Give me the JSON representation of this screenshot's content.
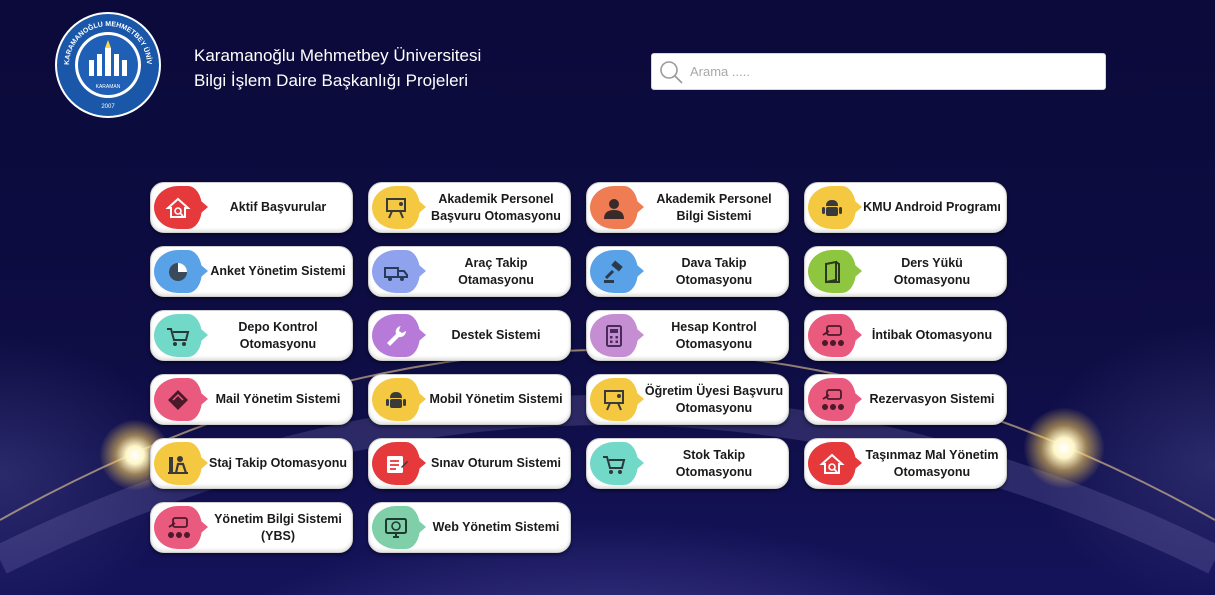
{
  "header": {
    "logo_icon": "university-seal-icon",
    "logo_text": "KARAMANOĞLU MEHMETBEY ÜNİVERSİTESİ",
    "logo_sub": "KARAMAN",
    "logo_year": "2007",
    "title_line1": "Karamanoğlu Mehmetbey Üniversitesi",
    "title_line2": "Bilgi İşlem Daire Başkanlığı Projeleri"
  },
  "search": {
    "placeholder": "Arama .....",
    "value": ""
  },
  "tiles": [
    {
      "label": "Aktif Başvurular",
      "icon": "house-search-icon",
      "color": "#e5393c"
    },
    {
      "label": "Akademik Personel Başvuru Otomasyonu",
      "icon": "presentation-board-icon",
      "color": "#f5c842"
    },
    {
      "label": "Akademik Personel Bilgi Sistemi",
      "icon": "person-silhouette-icon",
      "color": "#ef7c52"
    },
    {
      "label": "KMU Android Programı",
      "icon": "android-icon",
      "color": "#f5c842"
    },
    {
      "label": "Anket Yönetim Sistemi",
      "icon": "pie-chart-icon",
      "color": "#5aa2e8"
    },
    {
      "label": "Araç Takip Otamasyonu",
      "icon": "truck-icon",
      "color": "#8ea2ee"
    },
    {
      "label": "Dava Takip Otomasyonu",
      "icon": "gavel-icon",
      "color": "#5aa2e8"
    },
    {
      "label": "Ders Yükü Otomasyonu",
      "icon": "book-icon",
      "color": "#8ec63f"
    },
    {
      "label": "Depo Kontrol Otomasyonu",
      "icon": "shopping-cart-icon",
      "color": "#72d8c8"
    },
    {
      "label": "Destek Sistemi",
      "icon": "wrench-icon",
      "color": "#b77ad9"
    },
    {
      "label": "Hesap Kontrol Otomasyonu",
      "icon": "calculator-icon",
      "color": "#c58ed2"
    },
    {
      "label": "İntibak Otomasyonu",
      "icon": "chat-network-icon",
      "color": "#ea5a7e"
    },
    {
      "label": "Mail Yönetim Sistemi",
      "icon": "envelope-icon",
      "color": "#ea5a7e"
    },
    {
      "label": "Mobil Yönetim Sistemi",
      "icon": "android-icon",
      "color": "#f5c842"
    },
    {
      "label": "Öğretim Üyesi Başvuru Otomasyonu",
      "icon": "presentation-board-icon",
      "color": "#f5c842"
    },
    {
      "label": "Rezervasyon Sistemi",
      "icon": "chat-network-icon",
      "color": "#ea5a7e"
    },
    {
      "label": "Staj Takip Otomasyonu",
      "icon": "worker-icon",
      "color": "#f5c842"
    },
    {
      "label": "Sınav Oturum Sistemi",
      "icon": "exam-sheet-icon",
      "color": "#e5393c"
    },
    {
      "label": "Stok Takip Otomasyonu",
      "icon": "shopping-cart-icon",
      "color": "#72d8c8"
    },
    {
      "label": "Taşınmaz Mal Yönetim Otomasyonu",
      "icon": "house-search-icon",
      "color": "#e5393c"
    },
    {
      "label": "Yönetim Bilgi Sistemi (YBS)",
      "icon": "chat-network-icon",
      "color": "#ea5a7e"
    },
    {
      "label": "Web Yönetim Sistemi",
      "icon": "web-monitor-icon",
      "color": "#7fcfa8"
    }
  ]
}
